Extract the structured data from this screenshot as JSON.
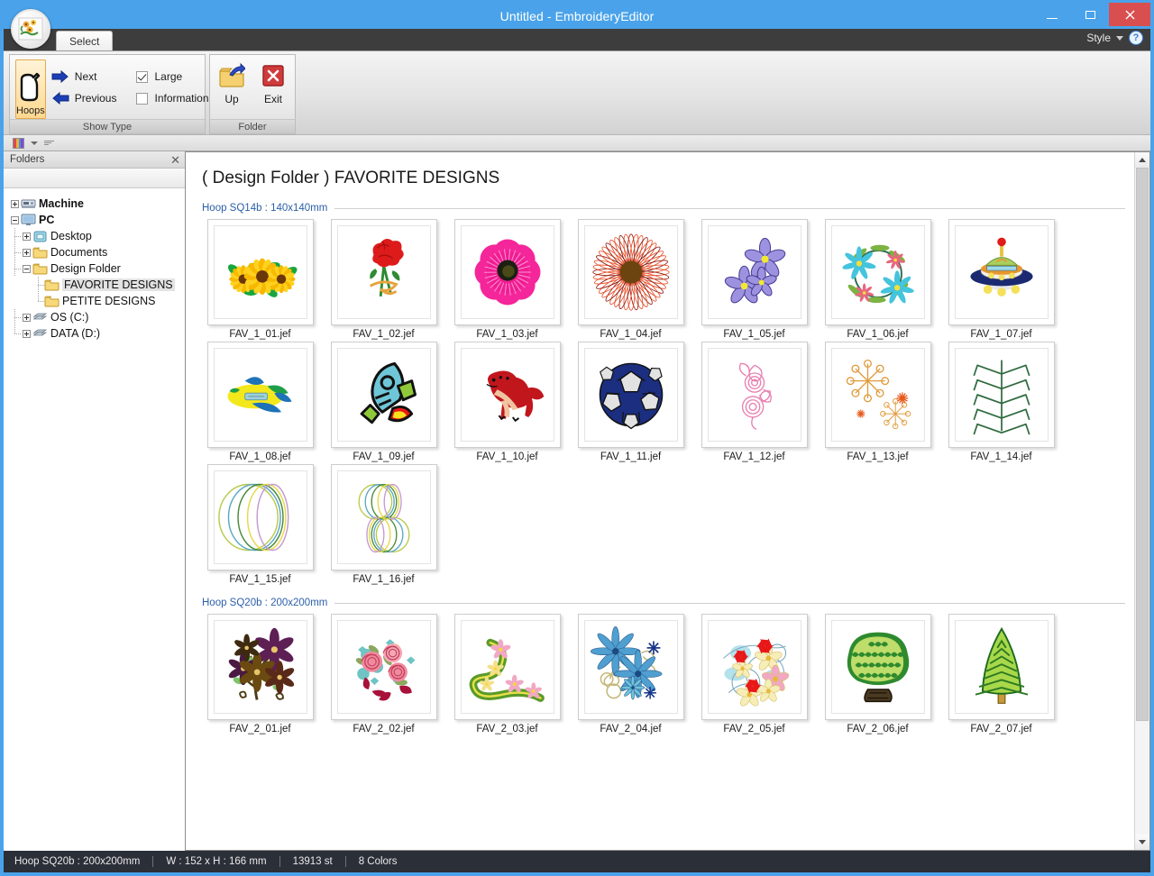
{
  "window": {
    "title": "Untitled - EmbroideryEditor",
    "minimize_label": "Minimize",
    "maximize_label": "Maximize",
    "close_label": "Close"
  },
  "ribbon": {
    "tabs": [
      {
        "label": "Select"
      }
    ],
    "style_label": "Style",
    "help_label": "?",
    "groups": [
      {
        "title": "Show Type",
        "big_button": {
          "label": "Hoops",
          "icon": "hoop-icon"
        },
        "nav": [
          {
            "label": "Next",
            "icon": "arrow-right-icon"
          },
          {
            "label": "Previous",
            "icon": "arrow-left-icon"
          }
        ],
        "checks": [
          {
            "label": "Large",
            "checked": true
          },
          {
            "label": "Information",
            "checked": false
          }
        ]
      },
      {
        "title": "Folder",
        "buttons": [
          {
            "label": "Up",
            "icon": "folder-up-icon"
          },
          {
            "label": "Exit",
            "icon": "close-red-icon"
          }
        ]
      }
    ]
  },
  "quick_access": {
    "color_swatch_icon": "color-palette-icon",
    "dropdown_icon": "chevron-down-icon",
    "menu_icon": "menu-bars-icon"
  },
  "folders_panel": {
    "header": "Folders",
    "close_icon": "close-icon",
    "tree": [
      {
        "label": "Machine",
        "icon": "machine-icon",
        "depth": 0,
        "expander": "plus",
        "bold": true,
        "selected": false
      },
      {
        "label": "PC",
        "icon": "pc-icon",
        "depth": 0,
        "expander": "minus",
        "bold": true,
        "selected": false
      },
      {
        "label": "Desktop",
        "icon": "desktop-icon",
        "depth": 1,
        "expander": "plus",
        "bold": false,
        "selected": false
      },
      {
        "label": "Documents",
        "icon": "folder-icon",
        "depth": 1,
        "expander": "plus",
        "bold": false,
        "selected": false
      },
      {
        "label": "Design Folder",
        "icon": "folder-icon",
        "depth": 1,
        "expander": "minus",
        "bold": false,
        "selected": false
      },
      {
        "label": "FAVORITE DESIGNS",
        "icon": "folder-icon",
        "depth": 2,
        "expander": "none",
        "bold": false,
        "selected": true
      },
      {
        "label": "PETITE DESIGNS",
        "icon": "folder-icon",
        "depth": 2,
        "expander": "none",
        "bold": false,
        "selected": false
      },
      {
        "label": "OS (C:)",
        "icon": "drive-icon",
        "depth": 1,
        "expander": "plus",
        "bold": false,
        "selected": false
      },
      {
        "label": "DATA (D:)",
        "icon": "drive-icon",
        "depth": 1,
        "expander": "plus",
        "bold": false,
        "selected": false
      }
    ]
  },
  "content": {
    "doc_title": "( Design Folder ) FAVORITE DESIGNS",
    "sections": [
      {
        "hoop_label": "Hoop SQ14b : 140x140mm",
        "rows": [
          [
            {
              "name": "FAV_1_01.jef",
              "art": "sunflowers"
            },
            {
              "name": "FAV_1_02.jef",
              "art": "carnation"
            },
            {
              "name": "FAV_1_03.jef",
              "art": "pink-anemone"
            },
            {
              "name": "FAV_1_04.jef",
              "art": "spiro-daisy"
            },
            {
              "name": "FAV_1_05.jef",
              "art": "violets"
            },
            {
              "name": "FAV_1_06.jef",
              "art": "floral-wreath"
            },
            {
              "name": "FAV_1_07.jef",
              "art": "ufo"
            }
          ],
          [
            {
              "name": "FAV_1_08.jef",
              "art": "airplane"
            },
            {
              "name": "FAV_1_09.jef",
              "art": "rocket"
            },
            {
              "name": "FAV_1_10.jef",
              "art": "dinosaur"
            },
            {
              "name": "FAV_1_11.jef",
              "art": "soccer-ball"
            },
            {
              "name": "FAV_1_12.jef",
              "art": "pink-swirl"
            },
            {
              "name": "FAV_1_13.jef",
              "art": "snowflakes"
            },
            {
              "name": "FAV_1_14.jef",
              "art": "chevron-leaf"
            }
          ],
          [
            {
              "name": "FAV_1_15.jef",
              "art": "circle-lines"
            },
            {
              "name": "FAV_1_16.jef",
              "art": "figure-eight"
            }
          ]
        ]
      },
      {
        "hoop_label": "Hoop SQ20b : 200x200mm",
        "rows": [
          [
            {
              "name": "FAV_2_01.jef",
              "art": "dark-floral"
            },
            {
              "name": "FAV_2_02.jef",
              "art": "roses"
            },
            {
              "name": "FAV_2_03.jef",
              "art": "green-ribbon"
            },
            {
              "name": "FAV_2_04.jef",
              "art": "blue-flowers"
            },
            {
              "name": "FAV_2_05.jef",
              "art": "pastel-garden"
            },
            {
              "name": "FAV_2_06.jef",
              "art": "round-tree"
            },
            {
              "name": "FAV_2_07.jef",
              "art": "pine-tree"
            }
          ]
        ]
      }
    ]
  },
  "status_bar": {
    "hoop": "Hoop SQ20b : 200x200mm",
    "size": "W : 152 x H : 166 mm",
    "stitches": "13913 st",
    "colors": "8 Colors"
  },
  "colors": {
    "title_bar": "#4aa3ea",
    "ribbon_dark": "#3d3d3d",
    "accent_blue": "#2b5fa8",
    "close_red": "#d94f4f",
    "status_bg": "#2b2f38",
    "highlight_orange": "#ffd88f"
  }
}
